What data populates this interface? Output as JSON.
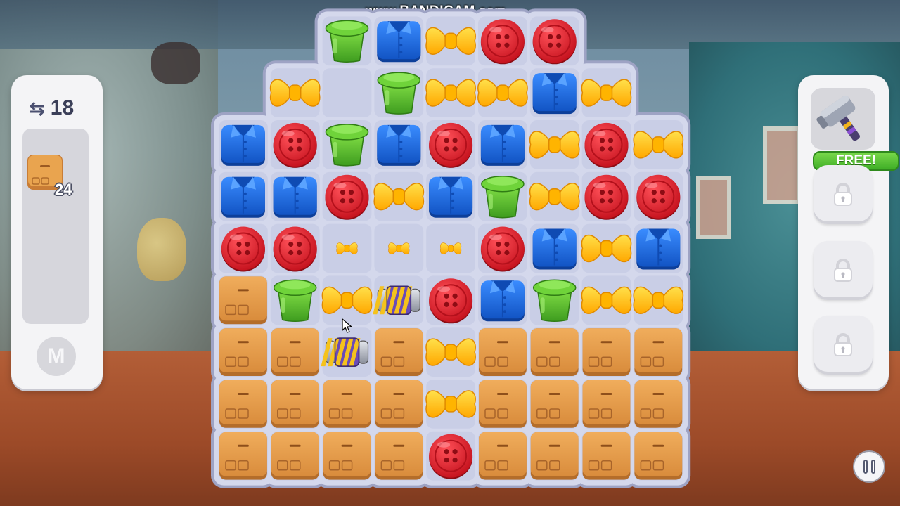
{
  "watermark": {
    "prefix": "www.",
    "brand": "BANDICAM",
    "suffix": ".com"
  },
  "moves": {
    "value": "18",
    "icon": "swap-arrows-icon"
  },
  "goal": {
    "item": "box",
    "remaining": "24"
  },
  "booster_bar": {
    "m_label": "M"
  },
  "powerups": {
    "hammer": {
      "badge": "FREE!",
      "icon": "hammer-icon"
    },
    "locked_slots": 3
  },
  "pause": {
    "icon": "pause-icon"
  },
  "colors": {
    "board": "#d4d8ec",
    "board_border": "#9ea3c4",
    "box": "#e7a04e",
    "button_red": "#e0212c",
    "shirt_blue": "#1f6ee0",
    "bow_yellow": "#ffc812",
    "cup_green": "#5fc42e",
    "free_green": "#3fae27"
  },
  "board": {
    "cols": 9,
    "rows": 9,
    "legend": {
      "B": "button",
      "S": "shirt",
      "W": "bow",
      "C": "cup",
      "X": "box",
      "w": "small-bow",
      "R": "rocket",
      "E": "empty",
      "-": "none"
    },
    "grid": [
      [
        "-",
        "-",
        "C",
        "S",
        "W",
        "B",
        "B",
        "-",
        "-"
      ],
      [
        "-",
        "W",
        "E",
        "C",
        "W",
        "W",
        "S",
        "W",
        "-"
      ],
      [
        "S",
        "B",
        "C",
        "S",
        "B",
        "S",
        "W",
        "B",
        "W"
      ],
      [
        "S",
        "S",
        "B",
        "W",
        "S",
        "C",
        "W",
        "B",
        "B"
      ],
      [
        "B",
        "B",
        "w",
        "w",
        "w",
        "B",
        "S",
        "W",
        "S"
      ],
      [
        "X",
        "C",
        "W",
        "R",
        "B",
        "S",
        "C",
        "W",
        "W"
      ],
      [
        "X",
        "X",
        "R",
        "X",
        "W",
        "X",
        "X",
        "X",
        "X"
      ],
      [
        "X",
        "X",
        "X",
        "X",
        "W",
        "X",
        "X",
        "X",
        "X"
      ],
      [
        "X",
        "X",
        "X",
        "X",
        "B",
        "X",
        "X",
        "X",
        "X"
      ]
    ]
  }
}
